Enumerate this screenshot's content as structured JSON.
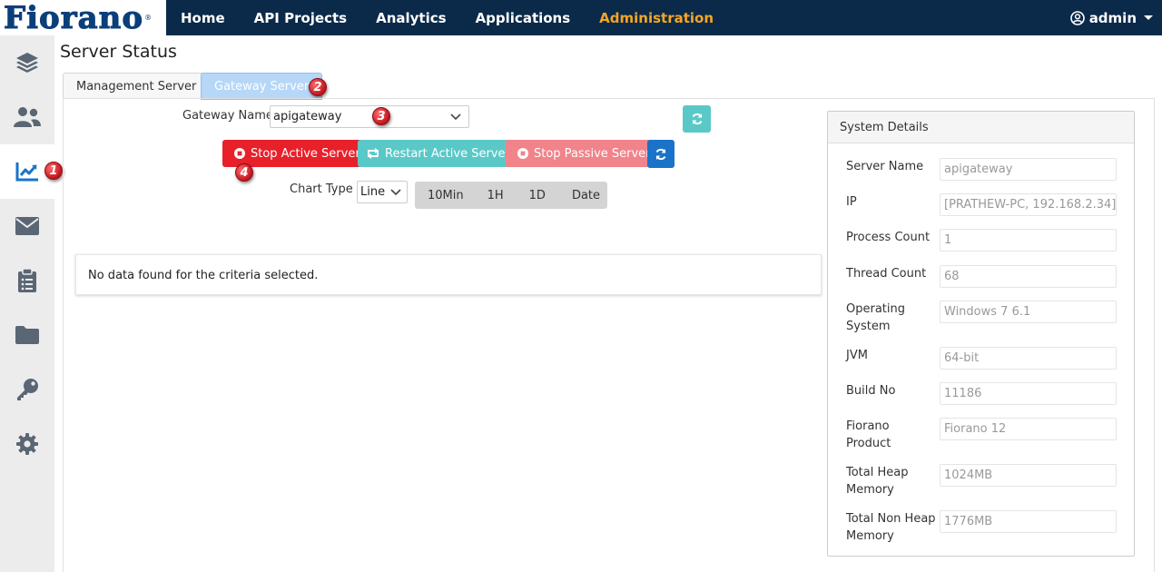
{
  "logo": {
    "text": "Fiorano",
    "reg": "®"
  },
  "nav": {
    "items": [
      {
        "label": "Home"
      },
      {
        "label": "API Projects"
      },
      {
        "label": "Analytics"
      },
      {
        "label": "Applications"
      },
      {
        "label": "Administration",
        "active": true
      }
    ],
    "user": "admin"
  },
  "sidebar": {
    "items": [
      {
        "icon": "layers-icon"
      },
      {
        "icon": "users-icon"
      },
      {
        "icon": "chart-line-icon",
        "active": true
      },
      {
        "icon": "envelope-icon"
      },
      {
        "icon": "clipboard-icon"
      },
      {
        "icon": "folder-icon"
      },
      {
        "icon": "key-icon"
      },
      {
        "icon": "gear-icon"
      }
    ]
  },
  "markers": [
    "1",
    "2",
    "3",
    "4"
  ],
  "page_title": "Server Status",
  "tabs": [
    {
      "label": "Management Server"
    },
    {
      "label": "Gateway Server",
      "active": true
    }
  ],
  "gateway": {
    "label": "Gateway Name",
    "value": "apigateway"
  },
  "buttons": {
    "stop_active": "Stop Active Server",
    "restart_active": "Restart Active Server",
    "stop_passive": "Stop Passive Server"
  },
  "chart_type": {
    "label": "Chart Type",
    "value": "Line",
    "ranges": [
      "10Min",
      "1H",
      "1D",
      "Date"
    ]
  },
  "no_data_message": "No data found for the criteria selected.",
  "system_details": {
    "title": "System Details",
    "fields": [
      {
        "label": "Server Name",
        "value": "apigateway"
      },
      {
        "label": "IP",
        "value": "[PRATHEW-PC, 192.168.2.34]"
      },
      {
        "label": "Process Count",
        "value": "1"
      },
      {
        "label": "Thread Count",
        "value": "68"
      },
      {
        "label": "Operating System",
        "value": "Windows 7 6.1"
      },
      {
        "label": "JVM",
        "value": "64-bit"
      },
      {
        "label": "Build No",
        "value": "11186"
      },
      {
        "label": "Fiorano Product",
        "value": "Fiorano 12"
      },
      {
        "label": "Total Heap Memory",
        "value": "1024MB"
      },
      {
        "label": "Total Non Heap Memory",
        "value": "1776MB"
      }
    ]
  },
  "colors": {
    "topbar": "#0b2a4a",
    "nav_active": "#f5a623",
    "stop_active": "#e8202a",
    "restart_active": "#5bc8c8",
    "stop_passive": "#f0848a",
    "refresh_primary": "#1a73c9",
    "refresh_teal": "#5bc8c8"
  }
}
